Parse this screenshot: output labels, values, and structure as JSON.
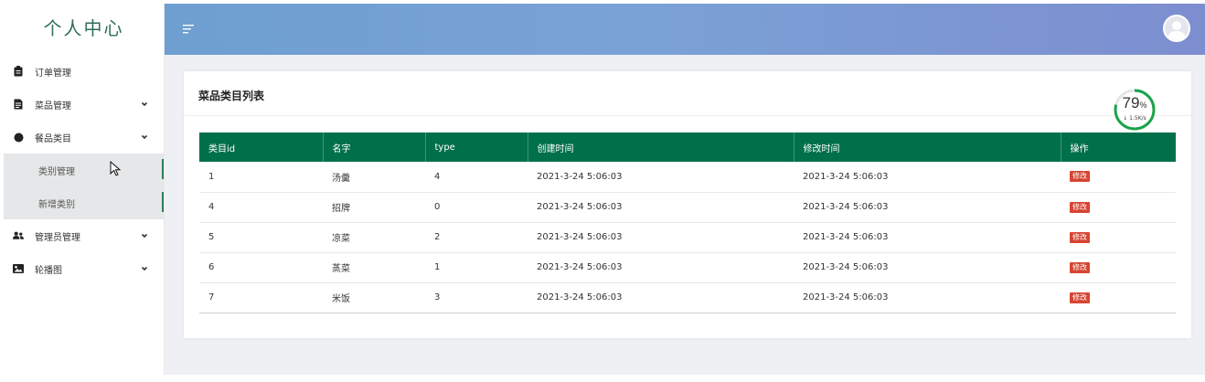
{
  "sidebar": {
    "brand": "个人中心",
    "items": [
      {
        "label": "订单管理",
        "icon": "clipboard-icon",
        "has_chevron": false
      },
      {
        "label": "菜品管理",
        "icon": "document-icon",
        "has_chevron": true
      },
      {
        "label": "餐品类目",
        "icon": "circle-icon",
        "has_chevron": true,
        "expanded": true,
        "children": [
          {
            "label": "类别管理",
            "active": true
          },
          {
            "label": "新增类别",
            "active": false
          }
        ]
      },
      {
        "label": "管理员管理",
        "icon": "users-icon",
        "has_chevron": true
      },
      {
        "label": "轮播图",
        "icon": "image-icon",
        "has_chevron": true
      }
    ]
  },
  "header": {
    "menu_icon": "hamburger-icon",
    "avatar_icon": "avatar-icon"
  },
  "card": {
    "title": "菜品类目列表"
  },
  "speed_widget": {
    "percent": "79",
    "unit": "%",
    "rate": "↓ 1.5K/s",
    "accent": "#1aa34a"
  },
  "table": {
    "columns": [
      "类目id",
      "名字",
      "type",
      "创建时间",
      "修改时间",
      "操作"
    ],
    "rows": [
      {
        "id": "1",
        "name": "汤羹",
        "type": "4",
        "created": "2021-3-24 5:06:03",
        "modified": "2021-3-24 5:06:03",
        "action": "修改"
      },
      {
        "id": "4",
        "name": "招牌",
        "type": "0",
        "created": "2021-3-24 5:06:03",
        "modified": "2021-3-24 5:06:03",
        "action": "修改"
      },
      {
        "id": "5",
        "name": "凉菜",
        "type": "2",
        "created": "2021-3-24 5:06:03",
        "modified": "2021-3-24 5:06:03",
        "action": "修改"
      },
      {
        "id": "6",
        "name": "蒸菜",
        "type": "1",
        "created": "2021-3-24 5:06:03",
        "modified": "2021-3-24 5:06:03",
        "action": "修改"
      },
      {
        "id": "7",
        "name": "米饭",
        "type": "3",
        "created": "2021-3-24 5:06:03",
        "modified": "2021-3-24 5:06:03",
        "action": "修改"
      }
    ]
  },
  "colors": {
    "primary": "#00704a",
    "danger": "#d64532",
    "brand_text": "#2e6e58"
  }
}
